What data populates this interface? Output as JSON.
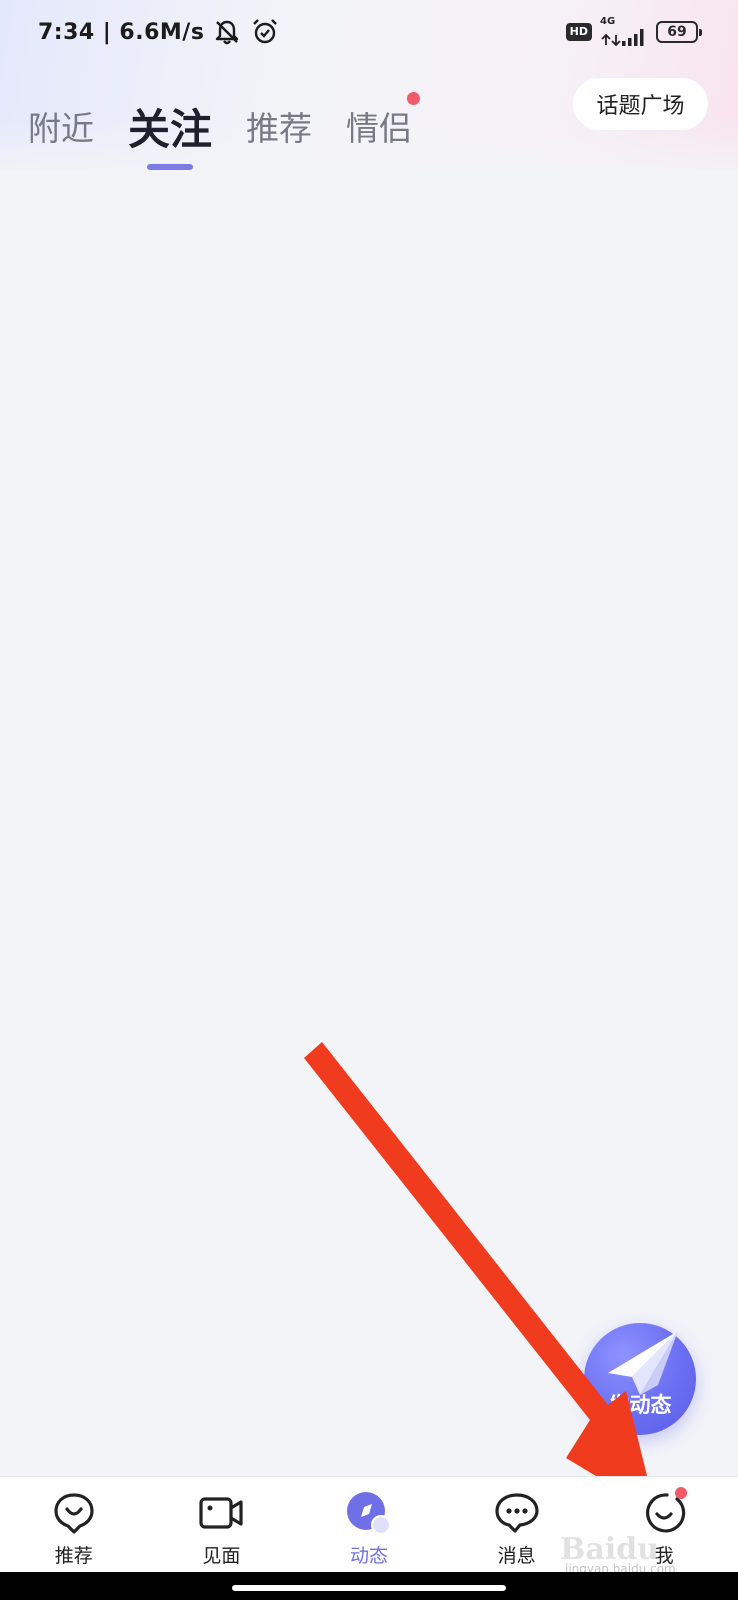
{
  "status_bar": {
    "time": "7:34",
    "speed": "| 6.6M/s",
    "hd": "HD",
    "network": "4G",
    "battery": "69",
    "icons": [
      "bell-muted-icon",
      "alarm-icon",
      "signal-icon"
    ]
  },
  "tabs": [
    {
      "label": "附近",
      "active": false,
      "dot": false
    },
    {
      "label": "关注",
      "active": true,
      "dot": false
    },
    {
      "label": "推荐",
      "active": false,
      "dot": false
    },
    {
      "label": "情侣",
      "active": false,
      "dot": true
    }
  ],
  "topic_button": "话题广场",
  "fab": {
    "label": "发动态",
    "icon": "paper-plane-icon"
  },
  "bottom_nav": [
    {
      "label": "推荐",
      "icon": "heart-bubble-icon",
      "active": false
    },
    {
      "label": "见面",
      "icon": "video-camera-icon",
      "active": false
    },
    {
      "label": "动态",
      "icon": "compass-icon",
      "active": true
    },
    {
      "label": "消息",
      "icon": "chat-bubble-icon",
      "active": false
    },
    {
      "label": "我",
      "icon": "smile-face-icon",
      "active": false,
      "dot": true
    }
  ],
  "watermark": {
    "text": "Baidu",
    "url": "jingyan.baidu.com"
  },
  "colors": {
    "accent": "#6f70e8",
    "badge_red": "#f25a6a",
    "arrow_red": "#f03b1f"
  }
}
